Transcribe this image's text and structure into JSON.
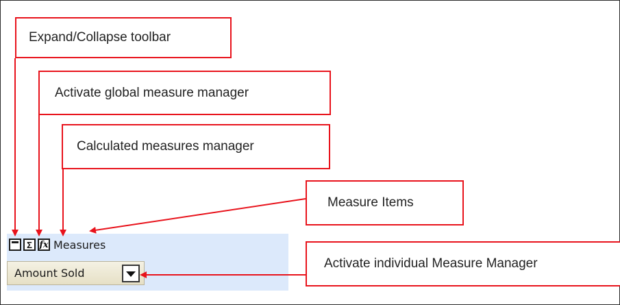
{
  "callouts": {
    "expand_collapse": "Expand/Collapse toolbar",
    "global_manager": "Activate global measure manager",
    "calculated_manager": "Calculated measures manager",
    "measure_items": "Measure Items",
    "individual_manager": "Activate individual Measure Manager"
  },
  "toolbar": {
    "expand_icon": "expand-collapse-icon",
    "sigma_icon": "sigma-icon",
    "fx_icon": "fx-icon",
    "sigma_glyph": "Σ",
    "fx_glyph": "fx",
    "measures_label": "Measures"
  },
  "measure_item": {
    "label": "Amount Sold",
    "dropdown_icon": "dropdown-arrow-icon"
  },
  "colors": {
    "callout_border": "#e8121b",
    "panel_bg": "#dce9fb",
    "item_bg": "#ebe6cf"
  }
}
